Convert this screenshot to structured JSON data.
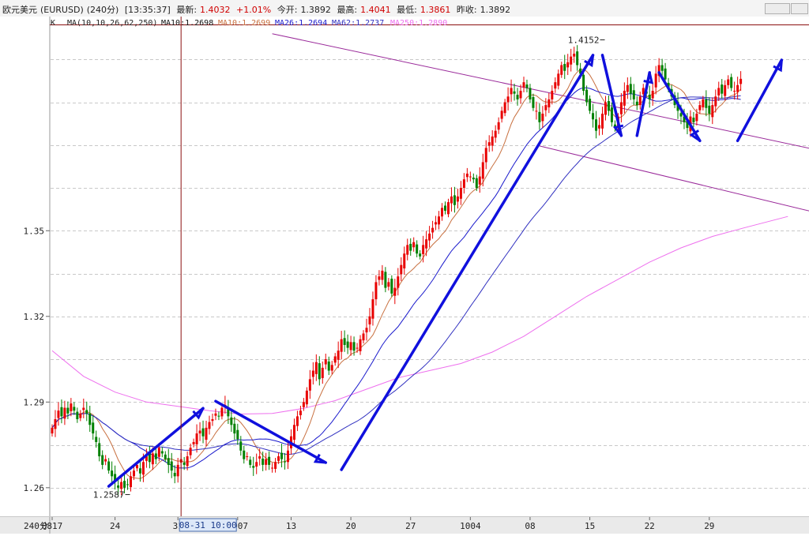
{
  "header": {
    "instrument": "欧元美元",
    "code": "(EURUSD)",
    "period": "(240分)",
    "time": "[13:35:37]",
    "last_label": "最新:",
    "last_value": "1.4032",
    "change": "+1.01%",
    "open_label": "今开:",
    "open_value": "1.3892",
    "high_label": "最高:",
    "high_value": "1.4041",
    "low_label": "最低:",
    "low_value": "1.3861",
    "prev_label": "昨收:",
    "prev_value": "1.3892"
  },
  "legend": {
    "k": "K",
    "ma_params": "MA(10,10,26,62,250)",
    "ma10a": "MA10:1.2698",
    "ma10b": "MA10:1.2699",
    "ma26": "MA26:1.2694",
    "ma62": "MA62:1.2737",
    "ma250": "MA250:1.2890"
  },
  "colors": {
    "candle_up": "#e80000",
    "candle_down": "#008000",
    "ma_short": "#c87040",
    "ma_mid": "#1a1acc",
    "ma_long": "#3030c0",
    "ma_250": "#ee70ee",
    "channel": "#9a2a9a",
    "arrow": "#1010dd",
    "crosshair": "#8b1010",
    "grid": "#c8c8c8"
  },
  "chart_data": {
    "type": "candlestick",
    "title": "欧元美元(EURUSD)(240分)",
    "ylim": [
      1.25,
      1.425
    ],
    "y_ticks": [
      {
        "value": 1.26,
        "label": "1.26"
      },
      {
        "value": 1.29,
        "label": "1.29"
      },
      {
        "value": 1.32,
        "label": "1.32"
      },
      {
        "value": 1.35,
        "label": "1.35"
      }
    ],
    "grid": true,
    "x_period_label": "240分",
    "x_labels": [
      {
        "label": "0817",
        "bar": 0
      },
      {
        "label": "24",
        "bar": 20
      },
      {
        "label": "31",
        "bar": 40
      },
      {
        "label": "0907",
        "bar": 59
      },
      {
        "label": "13",
        "bar": 76
      },
      {
        "label": "20",
        "bar": 95
      },
      {
        "label": "27",
        "bar": 114
      },
      {
        "label": "1004",
        "bar": 133
      },
      {
        "label": "08",
        "bar": 152
      },
      {
        "label": "15",
        "bar": 171
      },
      {
        "label": "22",
        "bar": 190
      },
      {
        "label": "29",
        "bar": 209
      }
    ],
    "crosshair": {
      "date_label": "08-31 10:00",
      "bar": 41
    },
    "annotations": [
      {
        "text": "1.2587",
        "price": 1.2587,
        "bar": 24,
        "kind": "low"
      },
      {
        "text": "1.4152",
        "price": 1.4152,
        "bar": 175,
        "kind": "high"
      }
    ],
    "channel_lines": [
      {
        "from": {
          "bar": 70,
          "price": 1.419
        },
        "to": {
          "bar": 265,
          "price": 1.3732
        }
      },
      {
        "from": {
          "bar": 155,
          "price": 1.3797
        },
        "to": {
          "bar": 265,
          "price": 1.3505
        }
      }
    ],
    "arrows": [
      {
        "from": {
          "bar": 18,
          "price": 1.2605
        },
        "to": {
          "bar": 48,
          "price": 1.2878
        }
      },
      {
        "from": {
          "bar": 52,
          "price": 1.2903
        },
        "to": {
          "bar": 87,
          "price": 1.2688
        }
      },
      {
        "from": {
          "bar": 92,
          "price": 1.2663
        },
        "to": {
          "bar": 172,
          "price": 1.4115
        }
      },
      {
        "from": {
          "bar": 175,
          "price": 1.4115
        },
        "to": {
          "bar": 181,
          "price": 1.3833
        }
      },
      {
        "from": {
          "bar": 186,
          "price": 1.3833
        },
        "to": {
          "bar": 190,
          "price": 1.4054
        }
      },
      {
        "from": {
          "bar": 193,
          "price": 1.4054
        },
        "to": {
          "bar": 206,
          "price": 1.3815
        }
      },
      {
        "from": {
          "bar": 218,
          "price": 1.3815
        },
        "to": {
          "bar": 232,
          "price": 1.4098
        }
      }
    ],
    "candles_closes": [
      1.281,
      1.284,
      1.287,
      1.285,
      1.288,
      1.286,
      1.2895,
      1.287,
      1.284,
      1.286,
      1.288,
      1.286,
      1.282,
      1.279,
      1.276,
      1.271,
      1.268,
      1.27,
      1.266,
      1.264,
      1.262,
      1.26,
      1.262,
      1.26,
      1.261,
      1.264,
      1.266,
      1.268,
      1.265,
      1.269,
      1.271,
      1.269,
      1.272,
      1.27,
      1.274,
      1.272,
      1.27,
      1.268,
      1.266,
      1.264,
      1.268,
      1.27,
      1.268,
      1.271,
      1.274,
      1.276,
      1.279,
      1.28,
      1.278,
      1.281,
      1.283,
      1.284,
      1.286,
      1.285,
      1.288,
      1.289,
      1.285,
      1.282,
      1.279,
      1.277,
      1.273,
      1.27,
      1.271,
      1.268,
      1.267,
      1.269,
      1.271,
      1.268,
      1.27,
      1.268,
      1.267,
      1.269,
      1.271,
      1.27,
      1.269,
      1.273,
      1.278,
      1.282,
      1.285,
      1.287,
      1.29,
      1.294,
      1.298,
      1.301,
      1.304,
      1.298,
      1.302,
      1.305,
      1.301,
      1.303,
      1.306,
      1.308,
      1.312,
      1.31,
      1.309,
      1.311,
      1.308,
      1.309,
      1.312,
      1.314,
      1.316,
      1.32,
      1.326,
      1.332,
      1.334,
      1.336,
      1.33,
      1.332,
      1.328,
      1.33,
      1.334,
      1.338,
      1.342,
      1.345,
      1.343,
      1.346,
      1.342,
      1.341,
      1.345,
      1.347,
      1.349,
      1.351,
      1.353,
      1.355,
      1.358,
      1.357,
      1.36,
      1.362,
      1.359,
      1.362,
      1.365,
      1.368,
      1.37,
      1.369,
      1.368,
      1.365,
      1.369,
      1.374,
      1.379,
      1.381,
      1.383,
      1.385,
      1.388,
      1.392,
      1.395,
      1.397,
      1.4,
      1.398,
      1.396,
      1.399,
      1.402,
      1.4,
      1.396,
      1.393,
      1.392,
      1.388,
      1.391,
      1.394,
      1.396,
      1.399,
      1.402,
      1.405,
      1.408,
      1.406,
      1.409,
      1.411,
      1.412,
      1.408,
      1.405,
      1.399,
      1.395,
      1.392,
      1.389,
      1.385,
      1.387,
      1.391,
      1.395,
      1.392,
      1.388,
      1.386,
      1.39,
      1.395,
      1.399,
      1.401,
      1.398,
      1.396,
      1.394,
      1.397,
      1.4,
      1.398,
      1.396,
      1.399,
      1.405,
      1.408,
      1.406,
      1.403,
      1.4,
      1.397,
      1.394,
      1.392,
      1.39,
      1.388,
      1.386,
      1.39,
      1.388,
      1.391,
      1.394,
      1.396,
      1.393,
      1.391,
      1.394,
      1.397,
      1.4,
      1.398,
      1.401,
      1.403,
      1.4,
      1.399,
      1.401,
      1.4032
    ],
    "ma250": [
      [
        0,
        1.308
      ],
      [
        10,
        1.299
      ],
      [
        20,
        1.2935
      ],
      [
        30,
        1.29
      ],
      [
        40,
        1.2885
      ],
      [
        50,
        1.287
      ],
      [
        60,
        1.2858
      ],
      [
        70,
        1.286
      ],
      [
        80,
        1.2878
      ],
      [
        90,
        1.2905
      ],
      [
        100,
        1.2945
      ],
      [
        110,
        1.2985
      ],
      [
        120,
        1.301
      ],
      [
        130,
        1.3035
      ],
      [
        140,
        1.3075
      ],
      [
        150,
        1.313
      ],
      [
        160,
        1.32
      ],
      [
        170,
        1.327
      ],
      [
        180,
        1.333
      ],
      [
        190,
        1.339
      ],
      [
        200,
        1.344
      ],
      [
        210,
        1.348
      ],
      [
        220,
        1.351
      ],
      [
        234,
        1.355
      ]
    ]
  }
}
